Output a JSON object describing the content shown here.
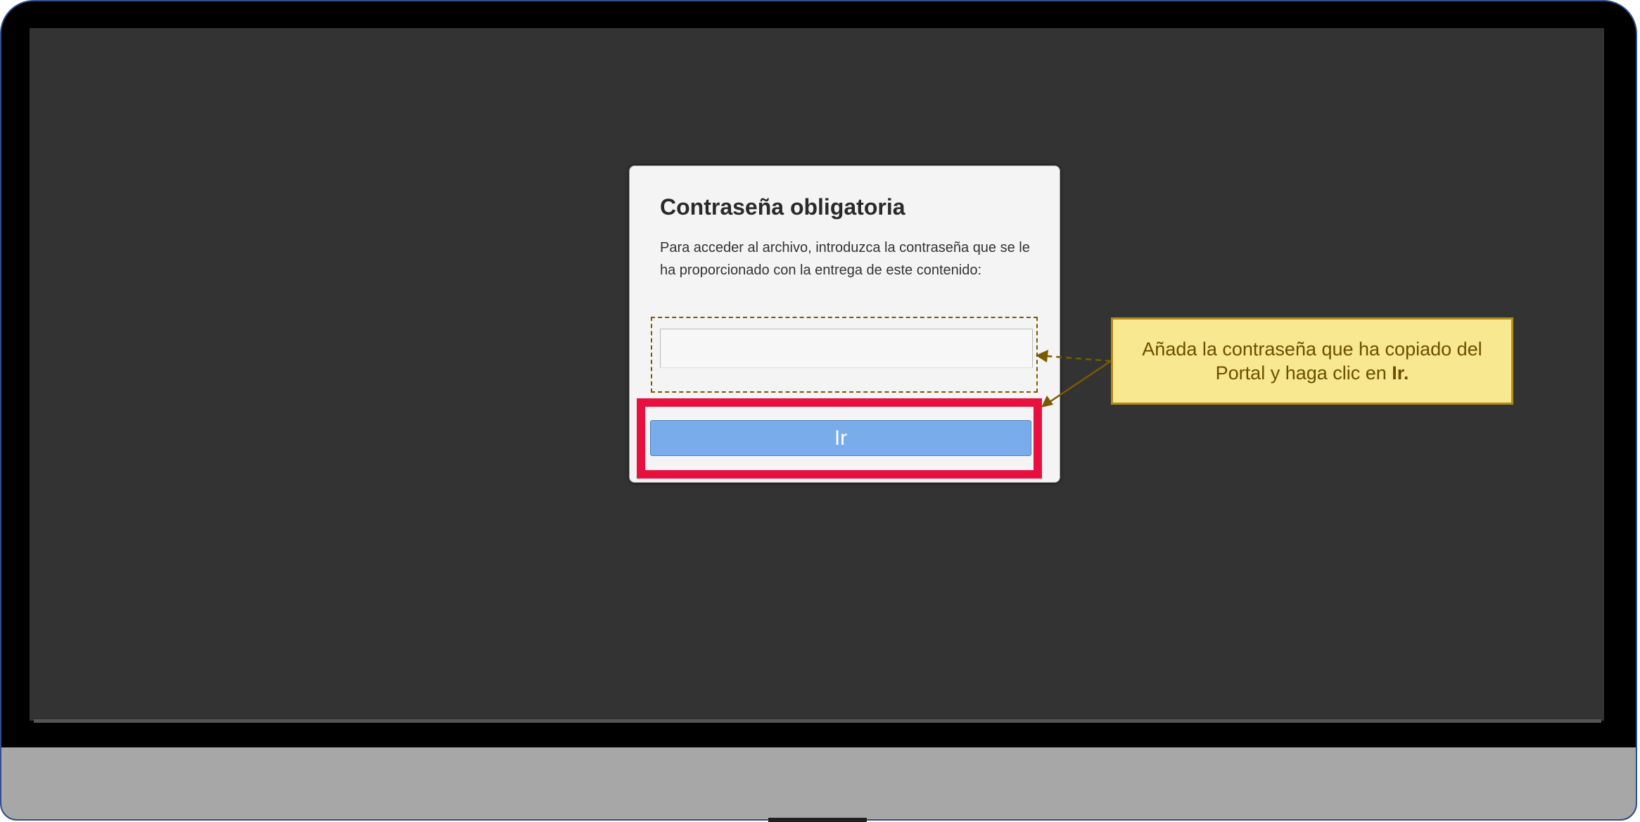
{
  "dialog": {
    "title": "Contraseña obligatoria",
    "description": "Para acceder al archivo, introduzca la contraseña que se le ha proporcionado con la entrega de este contenido:",
    "password_value": "",
    "button_label": "Ir"
  },
  "callout": {
    "text_before": "Añada la contraseña que ha copiado del Portal y haga clic en ",
    "text_bold": "Ir.",
    "background_color": "#f8e88f",
    "text_color": "#6b4f00"
  },
  "colors": {
    "screen_background": "#333333",
    "button_highlight": "#e8103f",
    "button_fill": "#78aceb",
    "monitor_chin": "#a7a7a7"
  },
  "icons": {
    "arrow_to_input": "dashed-arrow-icon",
    "arrow_to_button": "arrow-icon"
  }
}
